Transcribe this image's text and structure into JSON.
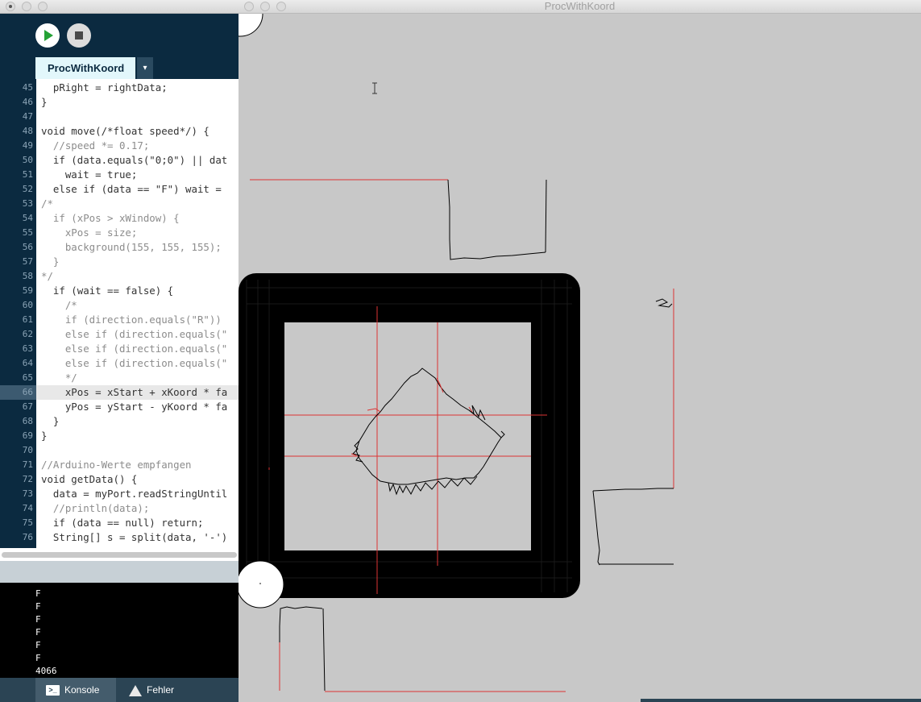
{
  "ide": {
    "sketch_tab": "ProcWithKoord",
    "tab_menu_glyph": "▾",
    "code_lines": [
      {
        "n": "45",
        "text": "  pRight = rightData;"
      },
      {
        "n": "46",
        "text": "}"
      },
      {
        "n": "47",
        "text": ""
      },
      {
        "n": "48",
        "text": "void move(/*float speed*/) {"
      },
      {
        "n": "49",
        "text": "  //speed *= 0.17;"
      },
      {
        "n": "50",
        "text": "  if (data.equals(\"0;0\") || dat"
      },
      {
        "n": "51",
        "text": "    wait = true;"
      },
      {
        "n": "52",
        "text": "  else if (data == \"F\") wait = "
      },
      {
        "n": "53",
        "text": "/*"
      },
      {
        "n": "54",
        "text": "  if (xPos > xWindow) {"
      },
      {
        "n": "55",
        "text": "    xPos = size;"
      },
      {
        "n": "56",
        "text": "    background(155, 155, 155);"
      },
      {
        "n": "57",
        "text": "  }"
      },
      {
        "n": "58",
        "text": "*/"
      },
      {
        "n": "59",
        "text": "  if (wait == false) {"
      },
      {
        "n": "60",
        "text": "    /*"
      },
      {
        "n": "61",
        "text": "    if (direction.equals(\"R\"))"
      },
      {
        "n": "62",
        "text": "    else if (direction.equals(\""
      },
      {
        "n": "63",
        "text": "    else if (direction.equals(\""
      },
      {
        "n": "64",
        "text": "    else if (direction.equals(\""
      },
      {
        "n": "65",
        "text": "    */"
      },
      {
        "n": "66",
        "text": "    xPos = xStart + xKoord * fa"
      },
      {
        "n": "67",
        "text": "    yPos = yStart - yKoord * fa"
      },
      {
        "n": "68",
        "text": "  }"
      },
      {
        "n": "69",
        "text": "}"
      },
      {
        "n": "70",
        "text": ""
      },
      {
        "n": "71",
        "text": "//Arduino-Werte empfangen"
      },
      {
        "n": "72",
        "text": "void getData() {"
      },
      {
        "n": "73",
        "text": "  data = myPort.readStringUntil"
      },
      {
        "n": "74",
        "text": "  //println(data);"
      },
      {
        "n": "75",
        "text": "  if (data == null) return;"
      },
      {
        "n": "76",
        "text": "  String[] s = split(data, '-')"
      }
    ],
    "current_line": "66",
    "console_lines": [
      "F",
      "F",
      "F",
      "F",
      "F",
      "F",
      "4066"
    ],
    "console_tabs": {
      "konsole": "Konsole",
      "fehler": "Fehler"
    },
    "konsole_icon_glyph": ">_"
  },
  "sketch": {
    "title": "ProcWithKoord",
    "background": "#c8c8c8",
    "track_color": "#000000",
    "grid_line_color": "#e03030"
  },
  "colors": {
    "ide_bg": "#0b2a40",
    "tab_active_bg": "#e2f7fb",
    "run_green": "#25a236"
  }
}
